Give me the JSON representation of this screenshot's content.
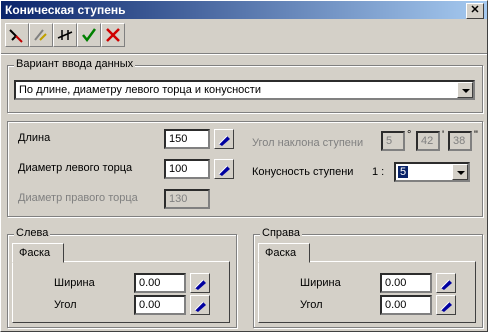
{
  "window": {
    "title": "Коническая ступень",
    "close_label": "✕"
  },
  "toolbar": {
    "buttons": [
      {
        "icon": "draw-pen-icon"
      },
      {
        "icon": "edit-pen-icon"
      },
      {
        "icon": "dimension-icon"
      },
      {
        "icon": "check-icon"
      },
      {
        "icon": "cancel-icon"
      }
    ]
  },
  "input_variant": {
    "legend": "Вариант ввода данных",
    "selected": "По длине, диаметру левого торца и конусности"
  },
  "params": {
    "length_label": "Длина",
    "length_value": "150",
    "left_diameter_label": "Диаметр левого торца",
    "left_diameter_value": "100",
    "right_diameter_label": "Диаметр правого торца",
    "right_diameter_value": "130",
    "angle_label": "Угол наклона ступени",
    "angle_deg": "5",
    "angle_deg_symbol": "°",
    "angle_min": "42",
    "angle_min_symbol": "'",
    "angle_sec": "38",
    "angle_sec_symbol": "\"",
    "taper_label": "Конусность ступени",
    "taper_prefix": "1 :",
    "taper_value": "5"
  },
  "left": {
    "legend": "Слева",
    "tab": "Фаска",
    "width_label": "Ширина",
    "width_value": "0.00",
    "angle_label": "Угол",
    "angle_value": "0.00"
  },
  "right": {
    "legend": "Справа",
    "tab": "Фаска",
    "width_label": "Ширина",
    "width_value": "0.00",
    "angle_label": "Угол",
    "angle_value": "0.00"
  }
}
